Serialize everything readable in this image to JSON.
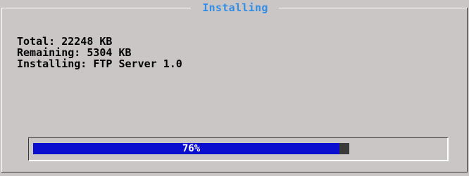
{
  "dialog": {
    "title": "Installing",
    "total": "Total: 22248 KB",
    "remaining": "Remaining: 5304 KB",
    "installing": "Installing: FTP Server 1.0"
  },
  "progress": {
    "percent": 0.968,
    "label": "76%"
  },
  "colors": {
    "background": "#cbc6c6",
    "title": "#2f8de8",
    "bar_fill": "#0b0ecf",
    "bar_track": "#3a3a3a"
  }
}
